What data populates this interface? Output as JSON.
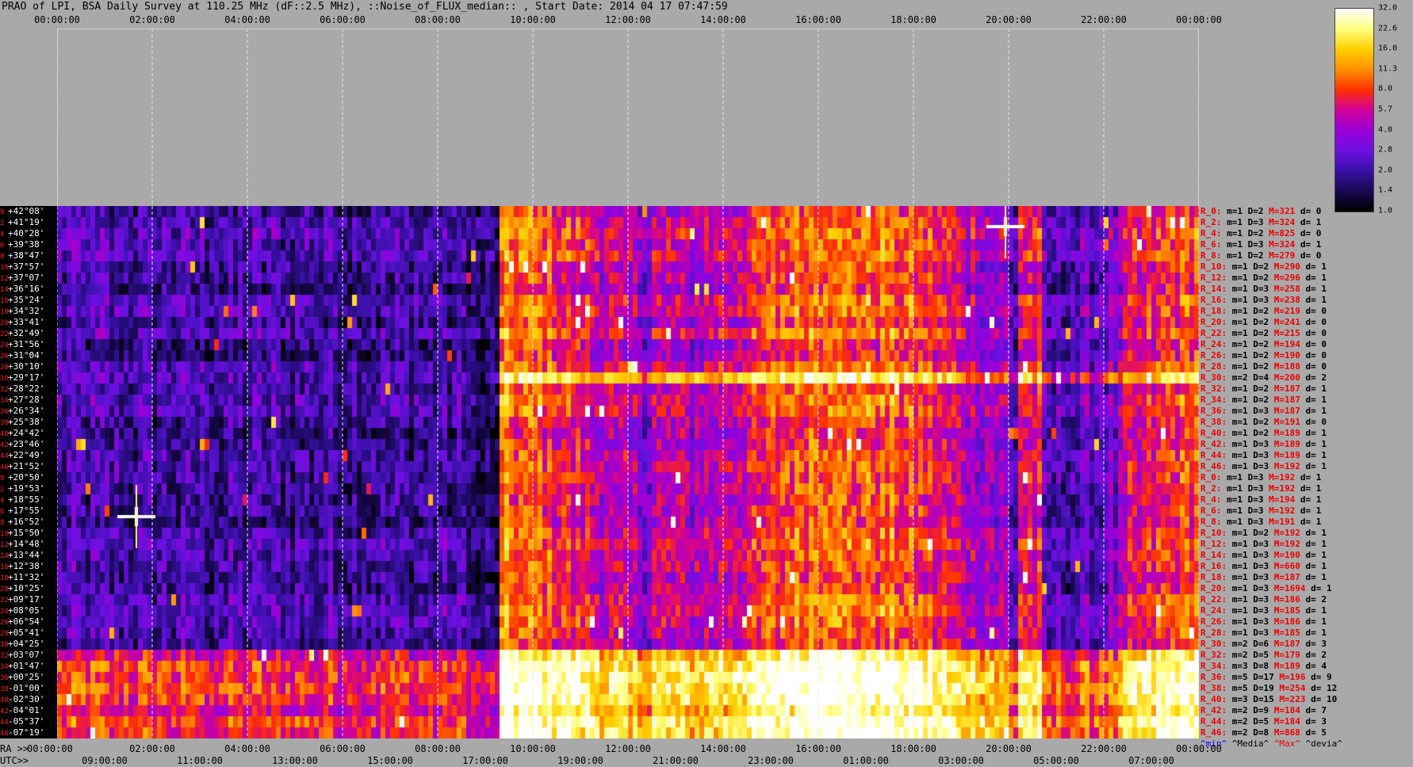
{
  "title": "PRAO of LPI, BSA Daily Survey at 110.25 MHz (dF::2.5 MHz), ::Noise_of_FLUX_median:: , Start Date: 2014 04 17 07:47:59",
  "colorbar": {
    "ticks": [
      "32.0",
      "22.6",
      "16.0",
      "11.3",
      "8.0",
      "5.7",
      "4.0",
      "2.8",
      "2.0",
      "1.4",
      "1.0"
    ],
    "colors": [
      "#ffffff",
      "#ffff80",
      "#ffd000",
      "#ff9000",
      "#ff3000",
      "#d0009a",
      "#9a00d8",
      "#6a10e0",
      "#3a10a8",
      "#180850",
      "#000000"
    ]
  },
  "axes": {
    "ra_prefix": "RA >>",
    "utc_prefix": "UTC>>",
    "top_ticks": [
      "00:00:00",
      "02:00:00",
      "04:00:00",
      "06:00:00",
      "08:00:00",
      "10:00:00",
      "12:00:00",
      "14:00:00",
      "16:00:00",
      "18:00:00",
      "20:00:00",
      "22:00:00",
      "00:00:00"
    ],
    "ra_ticks": [
      "00:00:00",
      "02:00:00",
      "04:00:00",
      "06:00:00",
      "08:00:00",
      "10:00:00",
      "12:00:00",
      "14:00:00",
      "16:00:00",
      "18:00:00",
      "20:00:00",
      "22:00:00",
      "00:00:00"
    ],
    "utc_ticks": [
      "09:00:00",
      "11:00:00",
      "13:00:00",
      "15:00:00",
      "17:00:00",
      "19:00:00",
      "21:00:00",
      "23:00:00",
      "01:00:00",
      "03:00:00",
      "05:00:00",
      "07:00:00"
    ]
  },
  "declination_labels": [
    "+42°08'",
    "+41°19'",
    "+40°28'",
    "+39°38'",
    "+38°47'",
    "+37°57'",
    "+37°07'",
    "+36°16'",
    "+35°24'",
    "+34°32'",
    "+33°41'",
    "+32°49'",
    "+31°56'",
    "+31°04'",
    "+30°10'",
    "+29°17'",
    "+28°22'",
    "+27°28'",
    "+26°34'",
    "+25°38'",
    "+24°42'",
    "+23°46'",
    "+22°49'",
    "+21°52'",
    "+20°50'",
    "+19°53'",
    "+18°55'",
    "+17°55'",
    "+16°52'",
    "+15°50'",
    "+14°48'",
    "+13°44'",
    "+12°38'",
    "+11°32'",
    "+10°25'",
    "+09°17'",
    "+08°05'",
    "+06°54'",
    "+05°41'",
    "+04°25'",
    "+03°07'",
    "+01°47'",
    "+00°25'",
    "-01°00'",
    "-02°30'",
    "-04°01'",
    "-05°37'",
    "-07°19'"
  ],
  "right_labels": [
    {
      "r": "R_0:",
      "m": "1",
      "d": "2",
      "h": "321",
      "dv": "0"
    },
    {
      "r": "R_2:",
      "m": "1",
      "d": "3",
      "h": "324",
      "dv": "1"
    },
    {
      "r": "R_4:",
      "m": "1",
      "d": "2",
      "h": "825",
      "dv": "0"
    },
    {
      "r": "R_6:",
      "m": "1",
      "d": "3",
      "h": "324",
      "dv": "1"
    },
    {
      "r": "R_8:",
      "m": "1",
      "d": "2",
      "h": "279",
      "dv": "0"
    },
    {
      "r": "R_10:",
      "m": "1",
      "d": "2",
      "h": "290",
      "dv": "1"
    },
    {
      "r": "R_12:",
      "m": "1",
      "d": "2",
      "h": "296",
      "dv": "1"
    },
    {
      "r": "R_14:",
      "m": "1",
      "d": "3",
      "h": "258",
      "dv": "1"
    },
    {
      "r": "R_16:",
      "m": "1",
      "d": "3",
      "h": "238",
      "dv": "1"
    },
    {
      "r": "R_18:",
      "m": "1",
      "d": "2",
      "h": "219",
      "dv": "0"
    },
    {
      "r": "R_20:",
      "m": "1",
      "d": "2",
      "h": "241",
      "dv": "0"
    },
    {
      "r": "R_22:",
      "m": "1",
      "d": "2",
      "h": "215",
      "dv": "0"
    },
    {
      "r": "R_24:",
      "m": "1",
      "d": "2",
      "h": "194",
      "dv": "0"
    },
    {
      "r": "R_26:",
      "m": "1",
      "d": "2",
      "h": "190",
      "dv": "0"
    },
    {
      "r": "R_28:",
      "m": "1",
      "d": "2",
      "h": "188",
      "dv": "0"
    },
    {
      "r": "R_30:",
      "m": "2",
      "d": "4",
      "h": "200",
      "dv": "2"
    },
    {
      "r": "R_32:",
      "m": "1",
      "d": "2",
      "h": "187",
      "dv": "1"
    },
    {
      "r": "R_34:",
      "m": "1",
      "d": "2",
      "h": "187",
      "dv": "1"
    },
    {
      "r": "R_36:",
      "m": "1",
      "d": "3",
      "h": "187",
      "dv": "1"
    },
    {
      "r": "R_38:",
      "m": "1",
      "d": "2",
      "h": "191",
      "dv": "0"
    },
    {
      "r": "R_40:",
      "m": "1",
      "d": "2",
      "h": "189",
      "dv": "1"
    },
    {
      "r": "R_42:",
      "m": "1",
      "d": "3",
      "h": "189",
      "dv": "1"
    },
    {
      "r": "R_44:",
      "m": "1",
      "d": "3",
      "h": "189",
      "dv": "1"
    },
    {
      "r": "R_46:",
      "m": "1",
      "d": "3",
      "h": "192",
      "dv": "1"
    },
    {
      "r": "R_0:",
      "m": "1",
      "d": "3",
      "h": "192",
      "dv": "1"
    },
    {
      "r": "R_2:",
      "m": "1",
      "d": "3",
      "h": "192",
      "dv": "1"
    },
    {
      "r": "R_4:",
      "m": "1",
      "d": "3",
      "h": "194",
      "dv": "1"
    },
    {
      "r": "R_6:",
      "m": "1",
      "d": "3",
      "h": "192",
      "dv": "1"
    },
    {
      "r": "R_8:",
      "m": "1",
      "d": "3",
      "h": "191",
      "dv": "1"
    },
    {
      "r": "R_10:",
      "m": "1",
      "d": "2",
      "h": "192",
      "dv": "1"
    },
    {
      "r": "R_12:",
      "m": "1",
      "d": "3",
      "h": "192",
      "dv": "1"
    },
    {
      "r": "R_14:",
      "m": "1",
      "d": "3",
      "h": "190",
      "dv": "1"
    },
    {
      "r": "R_16:",
      "m": "1",
      "d": "3",
      "h": "660",
      "dv": "1"
    },
    {
      "r": "R_18:",
      "m": "1",
      "d": "3",
      "h": "187",
      "dv": "1"
    },
    {
      "r": "R_20:",
      "m": "1",
      "d": "3",
      "h": "1694",
      "dv": "1"
    },
    {
      "r": "R_22:",
      "m": "1",
      "d": "3",
      "h": "186",
      "dv": "2"
    },
    {
      "r": "R_24:",
      "m": "1",
      "d": "3",
      "h": "185",
      "dv": "1"
    },
    {
      "r": "R_26:",
      "m": "1",
      "d": "3",
      "h": "186",
      "dv": "1"
    },
    {
      "r": "R_28:",
      "m": "1",
      "d": "3",
      "h": "185",
      "dv": "1"
    },
    {
      "r": "R_30:",
      "m": "2",
      "d": "6",
      "h": "187",
      "dv": "3"
    },
    {
      "r": "R_32:",
      "m": "2",
      "d": "5",
      "h": "179",
      "dv": "2"
    },
    {
      "r": "R_34:",
      "m": "3",
      "d": "8",
      "h": "189",
      "dv": "4"
    },
    {
      "r": "R_36:",
      "m": "5",
      "d": "17",
      "h": "196",
      "dv": "9"
    },
    {
      "r": "R_38:",
      "m": "5",
      "d": "19",
      "h": "254",
      "dv": "12"
    },
    {
      "r": "R_40:",
      "m": "3",
      "d": "15",
      "h": "223",
      "dv": "10"
    },
    {
      "r": "R_42:",
      "m": "2",
      "d": "9",
      "h": "184",
      "dv": "7"
    },
    {
      "r": "R_44:",
      "m": "2",
      "d": "5",
      "h": "184",
      "dv": "3"
    },
    {
      "r": "R_46:",
      "m": "2",
      "d": "8",
      "h": "868",
      "dv": "5"
    }
  ],
  "legend": {
    "min": "^min^",
    "median": "^Media^",
    "max": "^Max^",
    "devia": "^devia^"
  },
  "chart_data": {
    "type": "heatmap",
    "title": "PRAO of LPI, BSA Daily Survey at 110.25 MHz (dF::2.5 MHz), ::Noise_of_FLUX_median:: , Start Date: 2014 04 17 07:47:59",
    "x_axis_ra": [
      "00:00:00",
      "02:00:00",
      "04:00:00",
      "06:00:00",
      "08:00:00",
      "10:00:00",
      "12:00:00",
      "14:00:00",
      "16:00:00",
      "18:00:00",
      "20:00:00",
      "22:00:00",
      "00:00:00"
    ],
    "x_axis_utc": [
      "09:00:00",
      "11:00:00",
      "13:00:00",
      "15:00:00",
      "17:00:00",
      "19:00:00",
      "21:00:00",
      "23:00:00",
      "01:00:00",
      "03:00:00",
      "05:00:00",
      "07:00:00"
    ],
    "rows": 48,
    "colorbar_range": [
      1.0,
      32.0
    ],
    "colorbar_scale": "log"
  }
}
